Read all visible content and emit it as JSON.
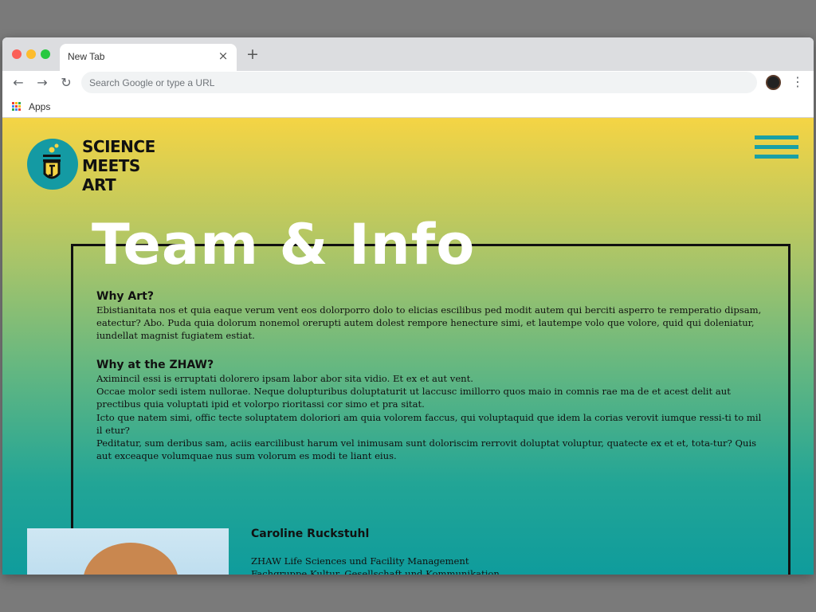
{
  "browser": {
    "tab_title": "New Tab",
    "tab_close": "×",
    "new_tab": "+",
    "back": "←",
    "forward": "→",
    "reload": "↻",
    "omnibox_placeholder": "Search Google or type a URL",
    "menu": "⋮",
    "bookmarks": {
      "apps_label": "Apps"
    }
  },
  "site": {
    "logo": {
      "lines": [
        "SCIENCE",
        "MEETS",
        "ART"
      ]
    },
    "page_title": "Team & Info",
    "sections": [
      {
        "heading": "Why Art?",
        "paragraphs": [
          "Ebistianitata nos et quia eaque verum vent eos dolorporro dolo to elicias escilibus ped modit autem qui berciti asperro te remperatio dipsam, eatectur? Abo. Puda quia dolorum nonemol orerupti autem dolest rempore henecture simi, et lautempe volo que volore, quid qui doleniatur, iundellat magnist fugiatem estiat."
        ]
      },
      {
        "heading": "Why at the ZHAW?",
        "paragraphs": [
          "Aximincil essi is erruptati dolorero ipsam labor abor sita vidio. Et ex et aut vent.",
          "Occae molor sedi istem nullorae. Neque dolupturibus doluptaturit ut laccusc imillorro quos maio in comnis rae ma de et acest delit aut prectibus quia voluptati ipid et volorpo rioritassi cor simo et pra sitat.",
          "Icto que natem simi, offic tecte soluptatem doloriori am quia volorem faccus, qui voluptaquid que idem la corias verovit iumque ressi-ti to mil il etur?",
          "Peditatur, sum deribus sam, aciis earcilibust harum vel inimusam sunt doloriscim rerrovit doluptat voluptur, quatecte ex et et, tota-tur? Quis aut exceaque volumquae nus sum volorum es modi te liant eius."
        ]
      }
    ],
    "team": [
      {
        "name": "Caroline Ruckstuhl",
        "lines": [
          "ZHAW Life Sciences und Facility Management",
          "Fachgruppe Kultur, Gesellschaft und Kommunikation"
        ]
      }
    ],
    "colors": {
      "gradient_top": "#f5d444",
      "gradient_bottom": "#0f9c9c",
      "accent": "#18a0a6"
    }
  }
}
